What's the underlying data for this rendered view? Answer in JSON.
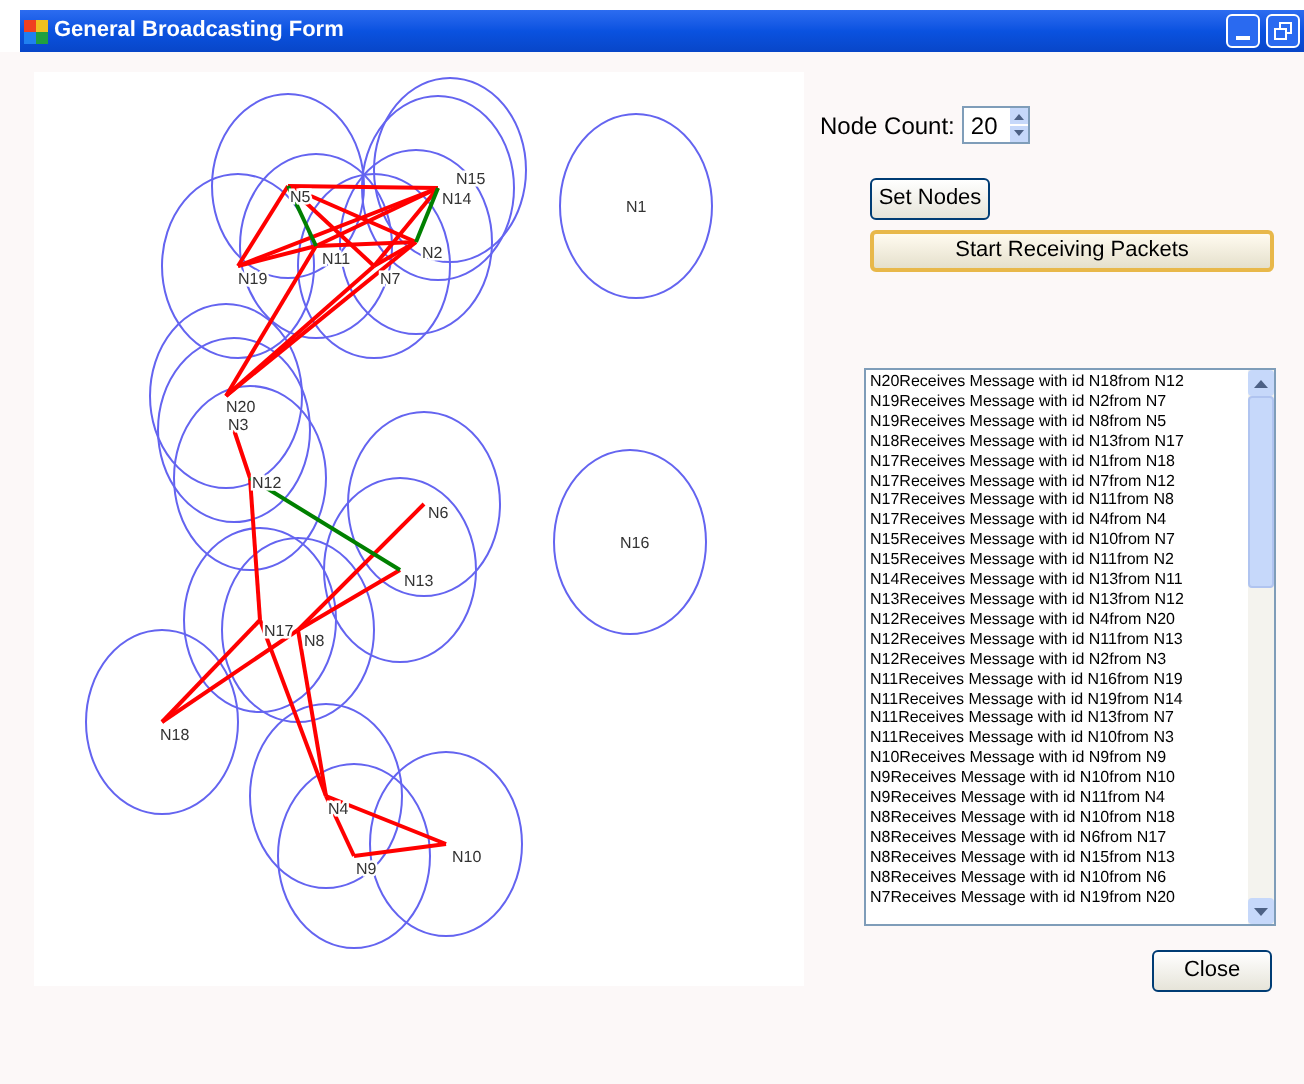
{
  "window": {
    "title": "General Broadcasting Form"
  },
  "graph": {
    "nodes": [
      {
        "label": "N1"
      },
      {
        "label": "N2"
      },
      {
        "label": "N3"
      },
      {
        "label": "N4"
      },
      {
        "label": "N5"
      },
      {
        "label": "N6"
      },
      {
        "label": "N7"
      },
      {
        "label": "N8"
      },
      {
        "label": "N9"
      },
      {
        "label": "N10"
      },
      {
        "label": "N11"
      },
      {
        "label": "N12"
      },
      {
        "label": "N13"
      },
      {
        "label": "N14"
      },
      {
        "label": "N15"
      },
      {
        "label": "N16"
      },
      {
        "label": "N17"
      },
      {
        "label": "N18"
      },
      {
        "label": "N19"
      },
      {
        "label": "N20"
      }
    ],
    "links": [
      {
        "color": "#ff0000"
      },
      {
        "color": "#ff0000"
      },
      {
        "color": "#ff0000"
      },
      {
        "color": "#ff0000"
      },
      {
        "color": "#ff0000"
      },
      {
        "color": "#ff0000"
      },
      {
        "color": "#ff0000"
      },
      {
        "color": "#ff0000"
      },
      {
        "color": "#ff0000"
      },
      {
        "color": "#ff0000"
      },
      {
        "color": "#ff0000"
      },
      {
        "color": "#ff0000"
      },
      {
        "color": "#ff0000"
      },
      {
        "color": "#ff0000"
      },
      {
        "color": "#ff0000"
      },
      {
        "color": "#ff0000"
      },
      {
        "color": "#ff0000"
      },
      {
        "color": "#ff0000"
      },
      {
        "color": "#ff0000"
      },
      {
        "color": "#ff0000"
      },
      {
        "color": "#ff0000"
      },
      {
        "color": "#ff0000"
      },
      {
        "color": "#ff0000"
      },
      {
        "color": "#ff0000"
      },
      {
        "color": "#008000"
      },
      {
        "color": "#008000"
      },
      {
        "color": "#008000"
      }
    ]
  },
  "node_count": {
    "label": "Node Count:",
    "value": "20"
  },
  "set_nodes_button": {
    "label": "Set Nodes"
  },
  "start_button": {
    "label": "Start Receiving Packets",
    "focused": true
  },
  "message_log": {
    "items": [
      "N20Receives Message with id N18from N12",
      "N19Receives Message with id N2from N7",
      "N19Receives Message with id N8from N5",
      "N18Receives Message with id N13from N17",
      "N17Receives Message with id N1from N18",
      "N17Receives Message with id N7from N12",
      "N17Receives Message with id N11from N8",
      "N17Receives Message with id N4from N4",
      "N15Receives Message with id N10from N7",
      "N15Receives Message with id N11from N2",
      "N14Receives Message with id N13from N11",
      "N13Receives Message with id N13from N12",
      "N12Receives Message with id N4from N20",
      "N12Receives Message with id N11from N13",
      "N12Receives Message with id N2from N3",
      "N11Receives Message with id N16from N19",
      "N11Receives Message with id N19from N14",
      "N11Receives Message with id N13from N7",
      "N11Receives Message with id N10from N3",
      "N10Receives Message with id N9from N9",
      "N9Receives Message with id N10from N10",
      "N9Receives Message with id N11from N4",
      "N8Receives Message with id N10from N18",
      "N8Receives Message with id N6from N17",
      "N8Receives Message with id N15from N13",
      "N8Receives Message with id N10from N6",
      "N7Receives Message with id N19from N20"
    ]
  },
  "close_button": {
    "label": "Close"
  }
}
